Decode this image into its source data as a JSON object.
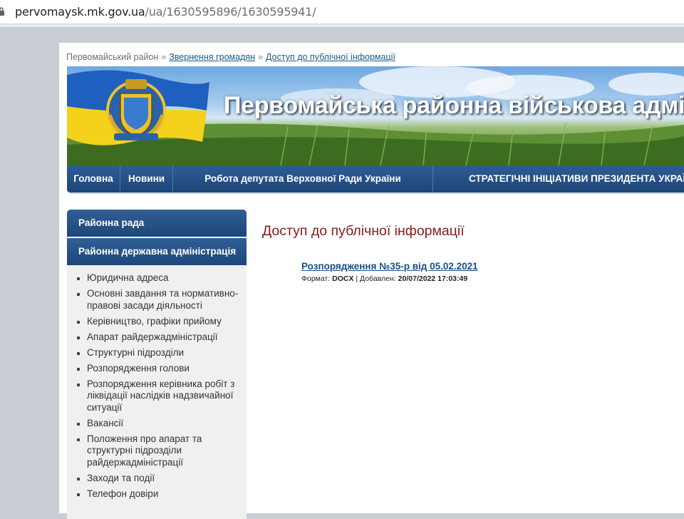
{
  "browser": {
    "url_host": "pervomaysk.mk.gov.ua",
    "url_path": "/ua/1630595896/1630595941/"
  },
  "breadcrumb": {
    "root": "Первомайський район",
    "sep": "»",
    "level1": "Звернення громадян",
    "level2": "Доступ до публічної інформації"
  },
  "banner": {
    "title": "Первомайська районна військова адміністрація"
  },
  "topnav": {
    "items": [
      "Головна",
      "Новини",
      "Робота депутата Верховної Ради України",
      "СТРАТЕГІЧНІ ІНІЦІАТИВИ ПРЕЗИДЕНТА УКРАЇНИ"
    ]
  },
  "sidebar": {
    "heads": [
      "Районна рада",
      "Районна державна адміністрація"
    ],
    "items": [
      "Юридична адреса",
      "Основні завдання та нормативно-правові засади діяльності",
      "Керівництво, графіки прийому",
      "Апарат райдержадміністрації",
      "Структурні підрозділи",
      "Розпорядження голови",
      "Розпорядження керівника робіт з ліквідації наслідків надзвичайної ситуації",
      "Вакансії",
      "Положення про апарат та структурні підрозділи райдержадміністрації",
      "Заходи та події",
      "Телефон довіри"
    ]
  },
  "content": {
    "title": "Доступ до публічної інформації",
    "doc_title": "Розпорядження №35-р від 05.02.2021",
    "meta_format_label": "Формат: ",
    "meta_format": "DOCX",
    "meta_added_label": " | Добавлен: ",
    "meta_added": "20/07/2022 17:03:49"
  },
  "colors": {
    "nav_blue": "#1d4577",
    "title_red": "#8b1a1a",
    "link_blue": "#1a4f80"
  },
  "icons": [
    "lock-icon",
    "coat-of-arms-icon"
  ]
}
